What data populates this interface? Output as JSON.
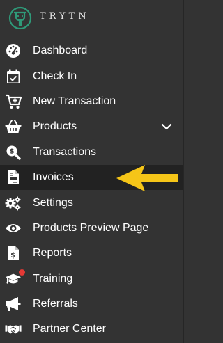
{
  "brand": {
    "name": "TRYTN",
    "logo_icon": "trytn-logo-icon"
  },
  "colors": {
    "background": "#333333",
    "active_background": "#222222",
    "text": "#ffffff",
    "logo": "#2f9a79",
    "badge": "#e53935",
    "pointer_arrow": "#f5c518"
  },
  "sidebar": {
    "items": [
      {
        "label": "Dashboard",
        "icon": "gauge-icon"
      },
      {
        "label": "Check In",
        "icon": "calendar-check-icon"
      },
      {
        "label": "New Transaction",
        "icon": "cart-plus-icon"
      },
      {
        "label": "Products",
        "icon": "basket-icon",
        "expandable": true
      },
      {
        "label": "Transactions",
        "icon": "search-dollar-icon"
      },
      {
        "label": "Invoices",
        "icon": "invoice-icon",
        "active": true
      },
      {
        "label": "Settings",
        "icon": "gears-icon"
      },
      {
        "label": "Products Preview Page",
        "icon": "eye-icon"
      },
      {
        "label": "Reports",
        "icon": "file-dollar-icon"
      },
      {
        "label": "Training",
        "icon": "graduation-cap-icon",
        "notification": true
      },
      {
        "label": "Referrals",
        "icon": "bullhorn-icon"
      },
      {
        "label": "Partner Center",
        "icon": "handshake-icon"
      }
    ]
  },
  "annotation": {
    "icon": "left-arrow-icon",
    "points_to": "Invoices"
  }
}
